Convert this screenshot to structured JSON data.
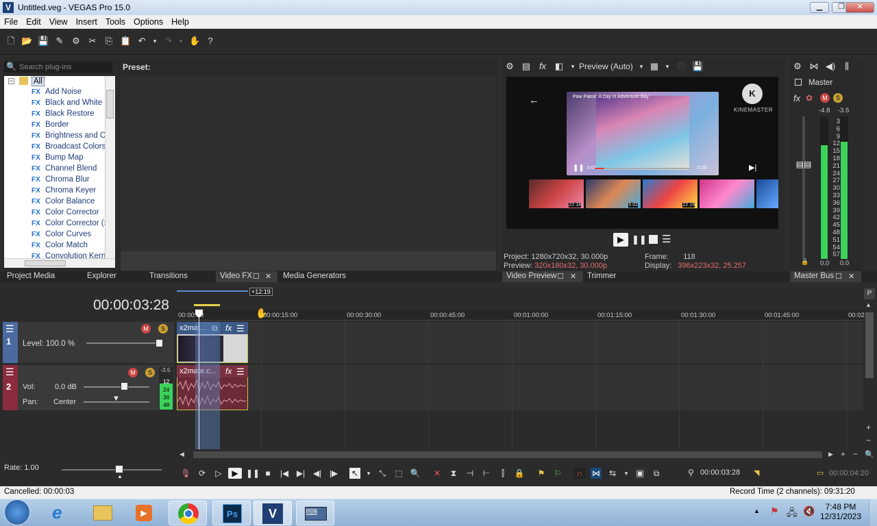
{
  "window": {
    "title": "Untitled.veg - VEGAS Pro 15.0",
    "app_icon": "V",
    "btn_min": "▁",
    "btn_max": "❐",
    "btn_close": "✕"
  },
  "menu": [
    "File",
    "Edit",
    "View",
    "Insert",
    "Tools",
    "Options",
    "Help"
  ],
  "plugins": {
    "search_placeholder": "Search plug-ins",
    "preset_label": "Preset:",
    "root": "All",
    "fx_badge": "FX",
    "items": [
      "Add Noise",
      "Black and White",
      "Black Restore",
      "Border",
      "Brightness and Co",
      "Broadcast Colors",
      "Bump Map",
      "Channel Blend",
      "Chroma Blur",
      "Chroma Keyer",
      "Color Balance",
      "Color Corrector",
      "Color Corrector (S",
      "Color Curves",
      "Color Match",
      "Convolution Kerne"
    ]
  },
  "tabs_left": [
    "Project Media",
    "Explorer",
    "Transitions",
    "Video FX",
    "Media Generators"
  ],
  "tabs_mid": [
    "Video Preview",
    "Trimmer"
  ],
  "tabs_right": [
    "Master Bus"
  ],
  "preview": {
    "mode": "Preview (Auto)",
    "project_label": "Project:",
    "project_value": "1280x720x32, 30.000p",
    "preview_label": "Preview:",
    "preview_value": "320x180x32, 30.000p",
    "frame_label": "Frame:",
    "frame_value": "118",
    "display_label": "Display:",
    "display_value": "396x223x32, 25.257",
    "brand": "KINEMASTER",
    "yt_title": "Paw Patrol: A Day in Adventure Bay",
    "yt_time_left": "0:02",
    "yt_time_right": "0:20",
    "thumbs": [
      "22:18",
      "5:02",
      "22:19",
      ""
    ]
  },
  "master": {
    "label": "Master",
    "peak_l": "-4.8",
    "peak_r": "-3.5",
    "scale": [
      "3",
      "6",
      "9",
      "12",
      "15",
      "18",
      "21",
      "24",
      "27",
      "30",
      "33",
      "36",
      "39",
      "42",
      "45",
      "48",
      "51",
      "54",
      "57"
    ],
    "bottom_l": "0.0",
    "bottom_r": "0.0",
    "level_l": 0.8,
    "level_r": 0.82
  },
  "timeline": {
    "time": "00:00:03:28",
    "loop_label": "+12:19",
    "ruler": [
      "00:00:00",
      "00:00:15:00",
      "00:00:30:00",
      "00:00:45:00",
      "00:01:00:00",
      "00:01:15:00",
      "00:01:30:00",
      "00:01:45:00",
      "00:02"
    ],
    "track1": {
      "num": "1",
      "level": "Level: 100.0 %",
      "clip": "x2mat..."
    },
    "track2": {
      "num": "2",
      "vol_label": "Vol:",
      "vol_value": "0.0 dB",
      "pan_label": "Pan:",
      "pan_value": "Center",
      "clip": "x2mate.c...",
      "meter_top": "-3.5",
      "meter_scale": [
        "12",
        "24",
        "36",
        "48"
      ]
    },
    "rate": "Rate: 1.00",
    "cursor_time": "00:00:03:28",
    "end_time": "00:00:04:20"
  },
  "status": {
    "left": "Cancelled: 00:00:03",
    "right": "Record Time (2 channels): 09:31:20"
  },
  "clock": {
    "time": "7:48 PM",
    "date": "12/31/2023"
  }
}
